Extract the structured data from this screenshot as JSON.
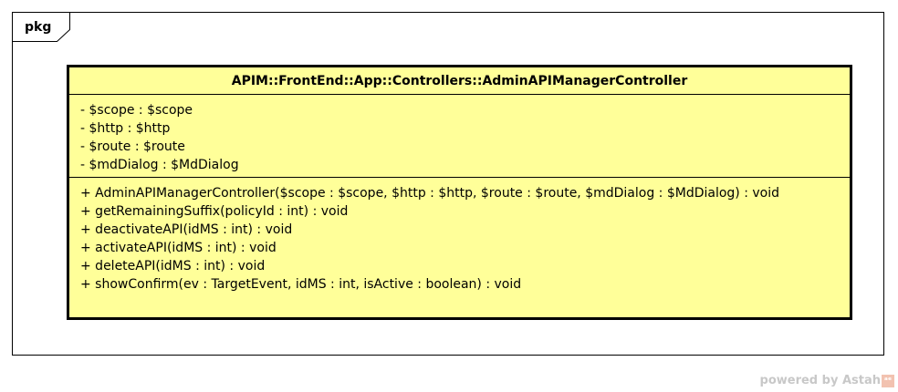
{
  "package": {
    "label": "pkg"
  },
  "class": {
    "name": "APIM::FrontEnd::App::Controllers::AdminAPIManagerController",
    "attributes": [
      "- $scope : $scope",
      "- $http : $http",
      "- $route : $route",
      "- $mdDialog : $MdDialog"
    ],
    "operations": [
      "+ AdminAPIManagerController($scope : $scope, $http : $http, $route : $route, $mdDialog : $MdDialog) : void",
      "+ getRemainingSuffix(policyId : int) : void",
      "+ deactivateAPI(idMS : int) : void",
      "+ activateAPI(idMS : int) : void",
      "+ deleteAPI(idMS : int) : void",
      "+ showConfirm(ev : TargetEvent, idMS : int, isActive : boolean) : void"
    ],
    "fill_color": "#ffff99"
  },
  "watermark": {
    "text": "powered by Astah"
  }
}
